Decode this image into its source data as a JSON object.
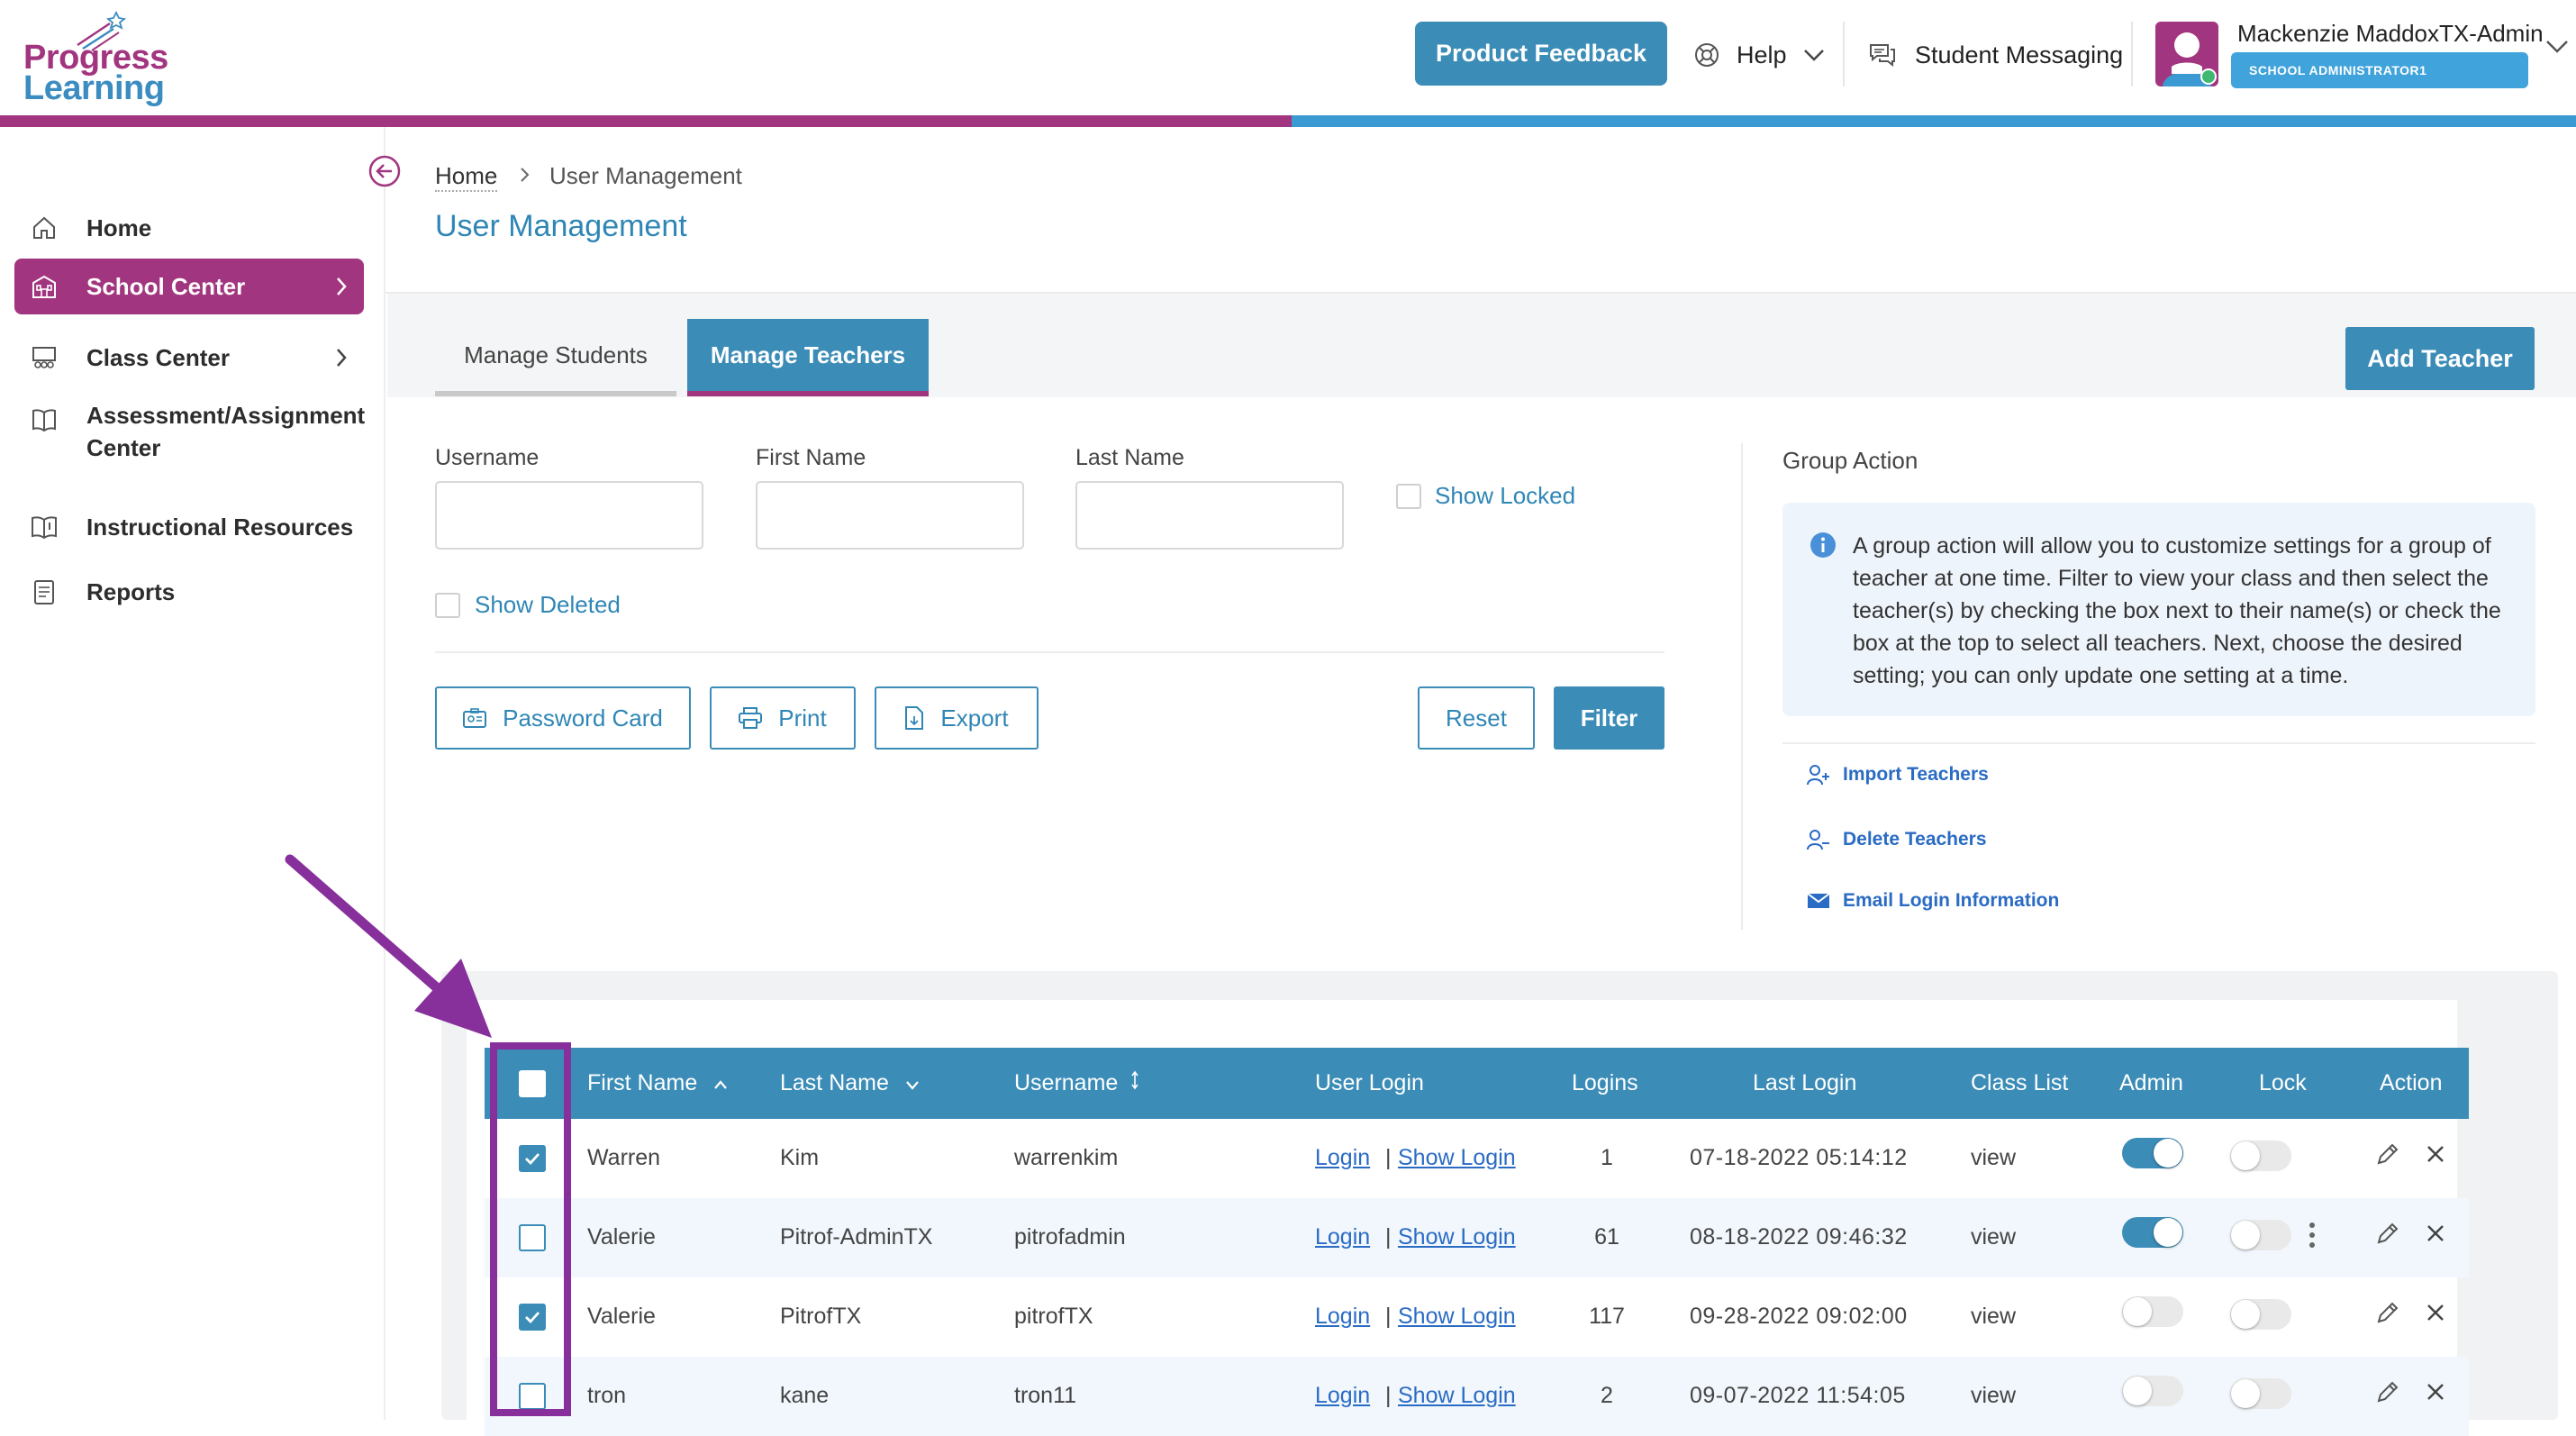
{
  "brand": {
    "line1": "Progress",
    "line2": "Learning"
  },
  "header": {
    "feedback_label": "Product Feedback",
    "help_label": "Help",
    "messaging_label": "Student Messaging",
    "user_name": "Mackenzie MaddoxTX-Admin",
    "user_role": "SCHOOL ADMINISTRATOR1"
  },
  "colors": {
    "brand_purple": "#a2357f",
    "brand_blue": "#3b8cb7",
    "link_blue": "#2a6bc4",
    "annotation_purple": "#872f9b"
  },
  "sidebar": {
    "items": [
      {
        "label": "Home",
        "icon": "home-icon",
        "active": false
      },
      {
        "label": "School Center",
        "icon": "school-icon",
        "active": true
      },
      {
        "label": "Class Center",
        "icon": "classroom-icon",
        "active": false
      },
      {
        "label": "Assessment/Assignment",
        "label2": "Center",
        "icon": "book-icon",
        "active": false
      },
      {
        "label": "Instructional Resources",
        "icon": "resources-icon",
        "active": false
      },
      {
        "label": "Reports",
        "icon": "report-icon",
        "active": false
      }
    ]
  },
  "breadcrumb": {
    "home": "Home",
    "current": "User Management"
  },
  "page_title": "User Management",
  "tabs": [
    {
      "label": "Manage Students",
      "active": false
    },
    {
      "label": "Manage Teachers",
      "active": true
    }
  ],
  "add_teacher_label": "Add Teacher",
  "filters": {
    "username_label": "Username",
    "username_value": "",
    "first_name_label": "First Name",
    "first_name_value": "",
    "last_name_label": "Last Name",
    "last_name_value": "",
    "show_locked_label": "Show Locked",
    "show_deleted_label": "Show Deleted"
  },
  "toolbar": {
    "password_card_label": "Password Card",
    "print_label": "Print",
    "export_label": "Export",
    "reset_label": "Reset",
    "filter_label": "Filter"
  },
  "group_action": {
    "title": "Group Action",
    "info": "A group action will allow you to customize settings for a group of teacher at one time. Filter to view your class and then select the teacher(s) by checking the box next to their name(s) or check the box at the top to select all teachers. Next, choose the desired setting; you can only update one setting at a time.",
    "links": [
      {
        "label": "Import Teachers",
        "icon": "user-plus-icon"
      },
      {
        "label": "Delete Teachers",
        "icon": "user-minus-icon"
      },
      {
        "label": "Email Login Information",
        "icon": "envelope-icon"
      }
    ]
  },
  "table": {
    "columns": {
      "first_name": "First Name",
      "last_name": "Last Name",
      "username": "Username",
      "user_login": "User Login",
      "logins": "Logins",
      "last_login": "Last Login",
      "class_list": "Class List",
      "admin": "Admin",
      "lock": "Lock",
      "action": "Action"
    },
    "login_link": "Login",
    "show_login_link": "Show Login",
    "view_link": "view",
    "rows": [
      {
        "selected": true,
        "first_name": "Warren",
        "last_name": "Kim",
        "username": "warrenkim",
        "logins": "1",
        "last_login": "07-18-2022 05:14:12",
        "admin": true,
        "lock": false
      },
      {
        "selected": false,
        "first_name": "Valerie",
        "last_name": "Pitrof-AdminTX",
        "username": "pitrofadmin",
        "logins": "61",
        "last_login": "08-18-2022 09:46:32",
        "admin": true,
        "lock": false
      },
      {
        "selected": true,
        "first_name": "Valerie",
        "last_name": "PitrofTX",
        "username": "pitrofTX",
        "logins": "117",
        "last_login": "09-28-2022 09:02:00",
        "admin": false,
        "lock": false
      },
      {
        "selected": false,
        "first_name": "tron",
        "last_name": "kane",
        "username": "tron11",
        "logins": "2",
        "last_login": "09-07-2022 11:54:05",
        "admin": false,
        "lock": false
      }
    ]
  }
}
